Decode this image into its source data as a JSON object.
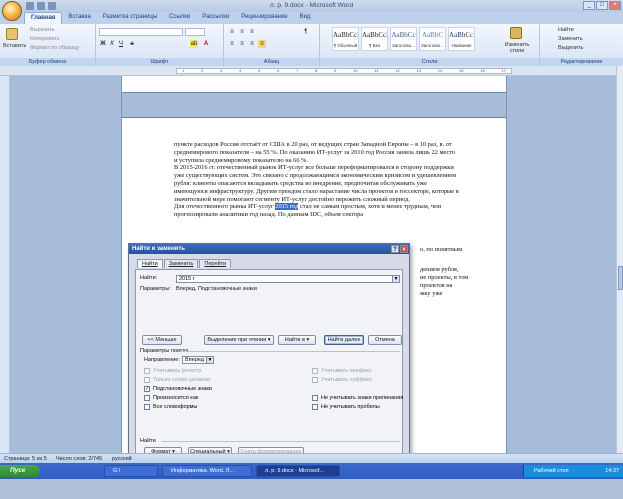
{
  "window": {
    "title": "л. р. 9.docx - Microsoft Word",
    "buttons": [
      "_",
      "□",
      "×"
    ]
  },
  "tabs": [
    "Главная",
    "Вставка",
    "Разметка страницы",
    "Ссылки",
    "Рассылки",
    "Рецензирование",
    "Вид"
  ],
  "ribbon": {
    "clipboard": {
      "paste": "Вставить",
      "cut": "Вырезать",
      "copy": "Копировать",
      "format_painter": "Формат по образцу",
      "label": "Буфер обмена"
    },
    "font": {
      "label": "Шрифт"
    },
    "paragraph": {
      "label": "Абзац"
    },
    "styles": {
      "label": "Стили",
      "items": [
        {
          "sample": "AaBbCcDc",
          "name": "¶ Обычный"
        },
        {
          "sample": "AaBbCcDc",
          "name": "¶ Без инте..."
        },
        {
          "sample": "AaBbCc",
          "name": "Заголово..."
        },
        {
          "sample": "AaBbC",
          "name": "Заголово..."
        },
        {
          "sample": "AaBbCcI",
          "name": "Название"
        }
      ],
      "change_styles": "Изменить стили"
    },
    "editing": {
      "label": "Редактирование",
      "find": "Найти",
      "replace": "Заменить",
      "select": "Выделить"
    }
  },
  "document": {
    "para1": "пункте расходов Россия отстаёт от США в 20 раз, от ведущих стран Западной Европы – в 10 раз, в. от среднемирового показателя – на 55 %. По оказанию ИТ-услуг за 2010 год Россия заняла лишь 22 место и уступила среднемировому показателю на 66 %.",
    "para2": "В 2015-2016 гг. отечественный рынок ИТ-услуг все больше переформатировался в сторону поддержки уже существующих систем. Это связано с продолжающимся экономическим кризисом и удешевлением рубля: клиенты опасаются вкладывать средства во внедрение, предпочитая обслуживать уже имеющуюся инфраструктуру. Другим трендом стало нарастание числа проектов в госсекторе, которые в значительной мере помогают сегменту ИТ-услуг достойно пережить сложный период.",
    "para3_before": "Для отечественного рынка ИТ-услуг ",
    "para3_highlight": "2015 год",
    "para3_after": " стал не самым простым, хотя и менее трудным, чем прогнозировали аналитики год назад. По данным IDC, объем сектора",
    "tail1": "о, по понятным",
    "tail2": "дением рубля,",
    "tail3": "ие проекты, в том",
    "tail4": "проектов на",
    "tail5": "жку уже"
  },
  "dialog": {
    "title": "Найти и заменить",
    "title_buttons": [
      "?",
      "×"
    ],
    "tabs": [
      "Найти",
      "Заменить",
      "Перейти"
    ],
    "find_label": "Найти:",
    "find_value": "2015 г",
    "params_label": "Параметры:",
    "params_value": "Вперед, Подстановочные знаки",
    "less_button": "<< Меньше",
    "highlight_button": "Выделение при чтении ▾",
    "find_in_button": "Найти в ▾",
    "find_next_button": "Найти далее",
    "cancel_button": "Отмена",
    "search_params_label": "Параметры поиска",
    "direction_label": "Направление:",
    "direction_value": "Вперед",
    "options_left": [
      {
        "label": "Учитывать регистр",
        "checked": false,
        "enabled": false
      },
      {
        "label": "Только слово целиком",
        "checked": false,
        "enabled": false
      },
      {
        "label": "Подстановочные знаки",
        "checked": true,
        "enabled": true
      },
      {
        "label": "Произносится как",
        "checked": false,
        "enabled": true
      },
      {
        "label": "Все словоформы",
        "checked": false,
        "enabled": true
      }
    ],
    "options_right": [
      {
        "label": "Учитывать префикс",
        "checked": false,
        "enabled": false
      },
      {
        "label": "Учитывать суффикс",
        "checked": false,
        "enabled": false
      },
      {
        "label": "Не учитывать знаки препинания",
        "checked": false,
        "enabled": true
      },
      {
        "label": "Не учитывать пробелы",
        "checked": false,
        "enabled": true
      }
    ],
    "find_section_label": "Найти",
    "format_button": "Формат ▾",
    "special_button": "Специальный ▾",
    "clear_format_button": "Снять форматирование"
  },
  "statusbar": {
    "page": "Страница: 5 из 5",
    "words": "Число слов: 2/745",
    "language": "русский"
  },
  "taskbar": {
    "start": "Пуск",
    "items": [
      "G:\\",
      "Информатика. Word. Л...",
      "л. р. 9.docx - Microsof..."
    ],
    "tray_label": "Рабочий стол",
    "clock": "14:37"
  }
}
